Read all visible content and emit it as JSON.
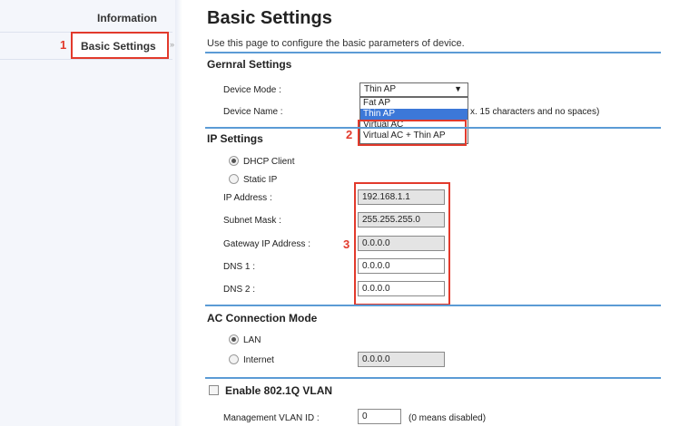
{
  "sidebar": {
    "items": [
      {
        "label": "Information"
      },
      {
        "label": "Basic Settings"
      }
    ],
    "arrow": "»"
  },
  "callouts": [
    "1",
    "2",
    "3"
  ],
  "page": {
    "title": "Basic Settings",
    "description": "Use this page to configure the basic parameters of device."
  },
  "general": {
    "title": "Gernral Settings",
    "device_mode_label": "Device Mode :",
    "device_mode_value": "Thin AP",
    "device_mode_options": [
      "Fat AP",
      "Thin AP",
      "Virtual AC",
      "Virtual AC + Thin AP"
    ],
    "device_name_label": "Device Name :",
    "device_name_hint": "x. 15 characters and no spaces)"
  },
  "ip": {
    "title": "IP Settings",
    "dhcp_label": "DHCP Client",
    "static_label": "Static IP",
    "address_label": "IP Address :",
    "address_value": "192.168.1.1",
    "mask_label": "Subnet Mask :",
    "mask_value": "255.255.255.0",
    "gateway_label": "Gateway IP Address :",
    "gateway_value": "0.0.0.0",
    "dns1_label": "DNS 1 :",
    "dns1_value": "0.0.0.0",
    "dns2_label": "DNS 2 :",
    "dns2_value": "0.0.0.0"
  },
  "ac": {
    "title": "AC Connection Mode",
    "lan_label": "LAN",
    "internet_label": "Internet",
    "internet_value": "0.0.0.0"
  },
  "vlan": {
    "title": "Enable 802.1Q VLAN",
    "mgmt_label": "Management VLAN ID :",
    "mgmt_value": "0",
    "mgmt_hint": "(0 means disabled)"
  },
  "colors": {
    "highlight": "#e23a2c",
    "section_line": "#5b9bd5",
    "selected_option": "#3c78d8"
  }
}
